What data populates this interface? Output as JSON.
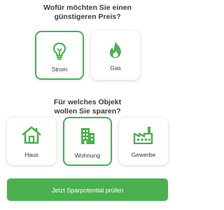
{
  "question1": {
    "line1": "Wofür möchten Sie einen",
    "line2": "günstigeren Preis?"
  },
  "energy_options": [
    {
      "label": "Strom",
      "icon": "lightbulb-icon",
      "selected": true
    },
    {
      "label": "Gas",
      "icon": "flame-icon",
      "selected": false
    }
  ],
  "question2": {
    "line1": "Für welches Objekt",
    "line2": "wollen Sie sparen?"
  },
  "object_options": [
    {
      "label": "Haus",
      "icon": "house-icon",
      "selected": false
    },
    {
      "label": "Wohnung",
      "icon": "apartment-building-icon",
      "selected": true
    },
    {
      "label": "Gewerbe",
      "icon": "factory-icon",
      "selected": false
    }
  ],
  "cta": {
    "label": "Jetzt Sparpotential prüfen"
  },
  "colors": {
    "accent": "#4caf50",
    "text": "#333333"
  }
}
